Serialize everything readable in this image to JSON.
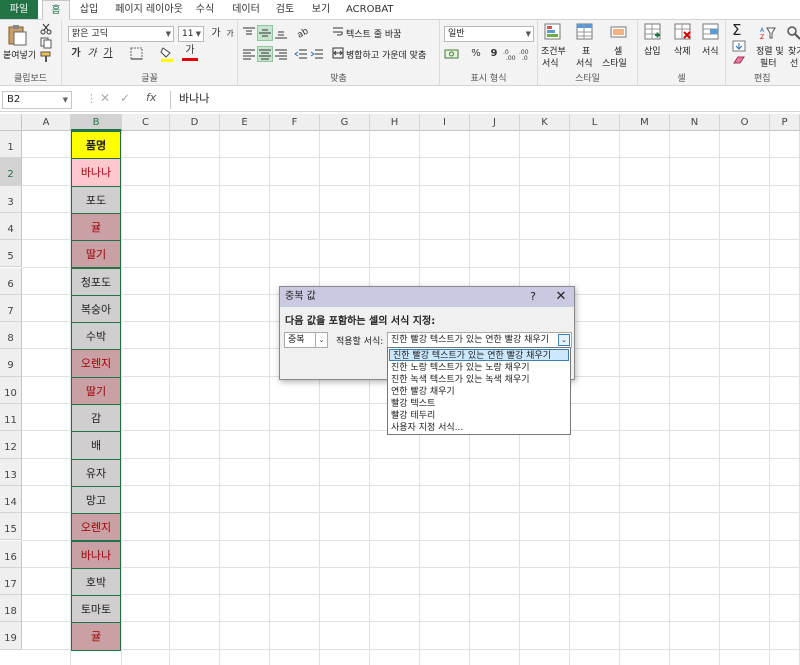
{
  "tabs": [
    "파일",
    "홈",
    "삽입",
    "페이지 레이아웃",
    "수식",
    "데이터",
    "검토",
    "보기",
    "ACROBAT"
  ],
  "ribbon": {
    "paste_label": "붙여넣기",
    "clipboard_label": "클립보드",
    "font_name": "맑은 고딕",
    "font_size": "11",
    "font_group_label": "글꼴",
    "bold": "가",
    "italic": "가",
    "underline": "가",
    "grow_font": "가",
    "shrink_font": "가",
    "font_color_glyph": "가",
    "wrap_text_label": "텍스트 줄 바꿈",
    "merge_center_label": "병합하고 가운데 맞춤",
    "align_group_label": "맞춤",
    "number_format": "일반",
    "percent": "%",
    "comma": "9",
    "number_group_label": "표시 형식",
    "cond_format_label_1": "조건부",
    "cond_format_label_2": "서식",
    "table_label_1": "표",
    "table_label_2": "서식",
    "cell_style_label_1": "셀",
    "cell_style_label_2": "스타일",
    "styles_group_label": "스타일",
    "insert_label": "삽입",
    "delete_label": "삭제",
    "format_label": "서식",
    "cells_group_label": "셀",
    "sort_label_1": "정렬 및",
    "sort_label_2": "필터",
    "find_label_1": "찾기",
    "find_label_2": "선",
    "editing_group_label": "편집"
  },
  "formula_bar": {
    "name_box": "B2",
    "fx": "fx",
    "content": "바나나"
  },
  "columns": [
    "A",
    "B",
    "C",
    "D",
    "E",
    "F",
    "G",
    "H",
    "I",
    "J",
    "K",
    "L",
    "M",
    "N",
    "O",
    "P"
  ],
  "rows": [
    "1",
    "2",
    "3",
    "4",
    "5",
    "6",
    "7",
    "8",
    "9",
    "10",
    "11",
    "12",
    "13",
    "14",
    "15",
    "16",
    "17",
    "18",
    "19"
  ],
  "column_b": [
    {
      "text": "품명",
      "style": "header"
    },
    {
      "text": "바나나",
      "style": "light"
    },
    {
      "text": "포도",
      "style": "gray"
    },
    {
      "text": "귤",
      "style": "dup"
    },
    {
      "text": "딸기",
      "style": "dup"
    },
    {
      "text": "청포도",
      "style": "gray"
    },
    {
      "text": "복숭아",
      "style": "gray"
    },
    {
      "text": "수박",
      "style": "gray"
    },
    {
      "text": "오렌지",
      "style": "dup"
    },
    {
      "text": "딸기",
      "style": "dup"
    },
    {
      "text": "감",
      "style": "gray"
    },
    {
      "text": "배",
      "style": "gray"
    },
    {
      "text": "유자",
      "style": "gray"
    },
    {
      "text": "망고",
      "style": "gray"
    },
    {
      "text": "오렌지",
      "style": "dup"
    },
    {
      "text": "바나나",
      "style": "dup"
    },
    {
      "text": "호박",
      "style": "gray"
    },
    {
      "text": "토마토",
      "style": "gray"
    },
    {
      "text": "귤",
      "style": "dup"
    }
  ],
  "cell_colors": {
    "header": "#ffff00",
    "light": "#ffc7ce",
    "gray": "#d0cece",
    "dup": "#c9a0a4",
    "dup_text": "#9c0006",
    "accent": "#217346"
  },
  "dialog": {
    "title": "중복 값",
    "help": "?",
    "close": "✕",
    "prompt": "다음 값을 포함하는 셀의 서식 지정:",
    "type_value": "중복",
    "apply_label": "적용할 서식:",
    "selected_format": "진한 빨강 텍스트가 있는 연한 빨강 채우기",
    "options": [
      "진한 빨강 텍스트가 있는 연한 빨강 채우기",
      "진한 노랑 텍스트가 있는 노랑 채우기",
      "진한 녹색 텍스트가 있는 녹색 채우기",
      "연한 빨강 채우기",
      "빨강 텍스트",
      "빨강 테두리",
      "사용자 지정 서식..."
    ]
  }
}
